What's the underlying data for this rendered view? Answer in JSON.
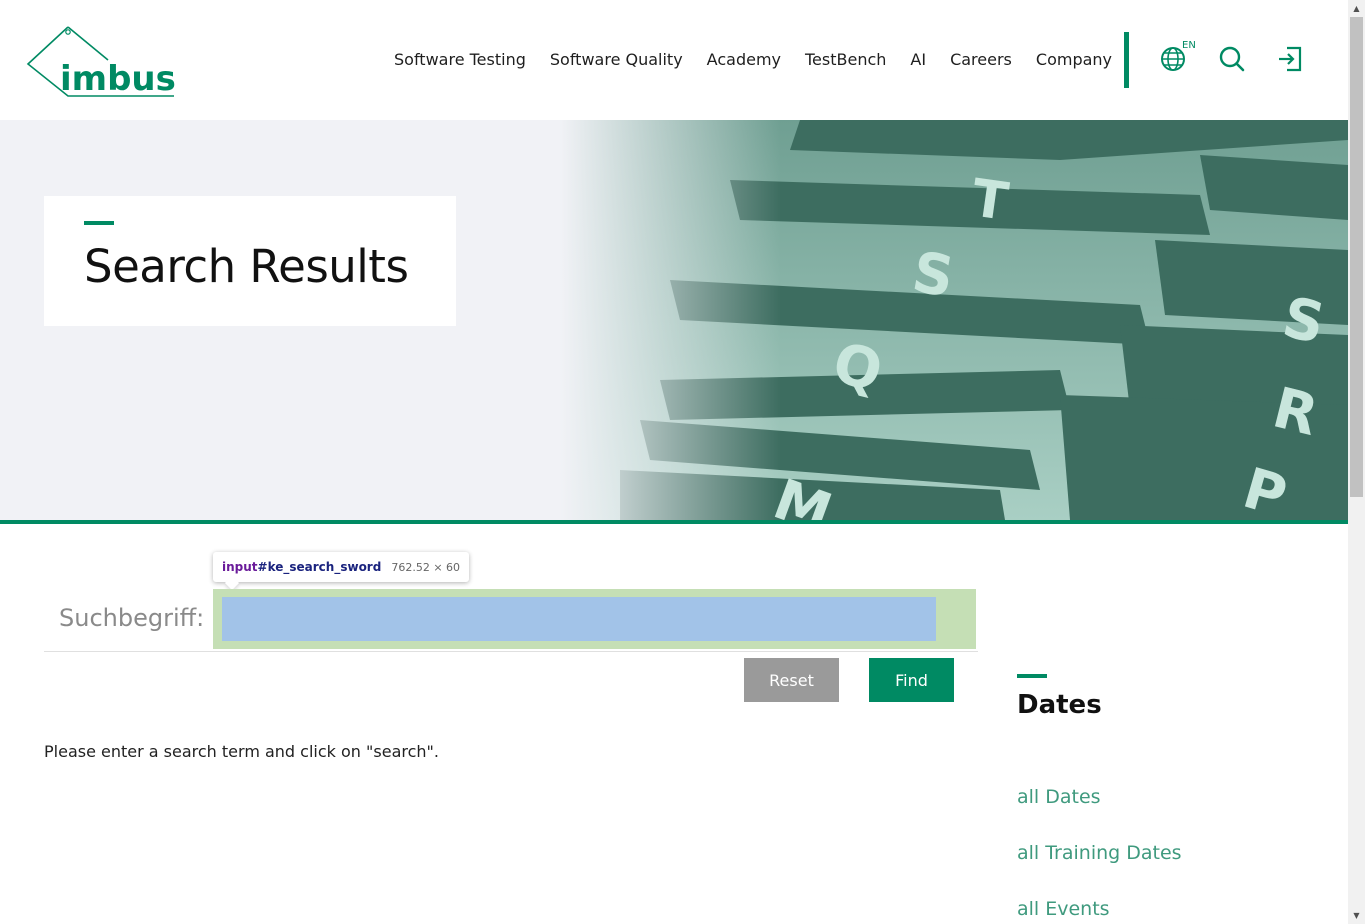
{
  "logo": {
    "text": "imbus"
  },
  "nav": {
    "items": [
      "Software Testing",
      "Software Quality",
      "Academy",
      "TestBench",
      "AI",
      "Careers",
      "Company"
    ]
  },
  "header_icons": {
    "language": {
      "icon": "globe-icon",
      "label": "EN"
    },
    "search": {
      "icon": "search-icon"
    },
    "login": {
      "icon": "login-icon"
    }
  },
  "hero": {
    "title": "Search Results"
  },
  "inspector_tooltip": {
    "tag": "input",
    "id": "#ke_search_sword",
    "dimensions": "762.52 × 60"
  },
  "search_form": {
    "label": "Suchbegriff:",
    "value": "",
    "reset_label": "Reset",
    "find_label": "Find",
    "hint": "Please enter a search term and click on \"search\"."
  },
  "sidebar": {
    "title": "Dates",
    "links": [
      "all Dates",
      "all Training Dates",
      "all Events"
    ]
  },
  "colors": {
    "brand_green": "#008a63",
    "link_green": "#3f9a7e",
    "reset_gray": "#9a9a9a",
    "highlight_margin": "#c5dfb5",
    "highlight_content": "#a2c3e8"
  }
}
